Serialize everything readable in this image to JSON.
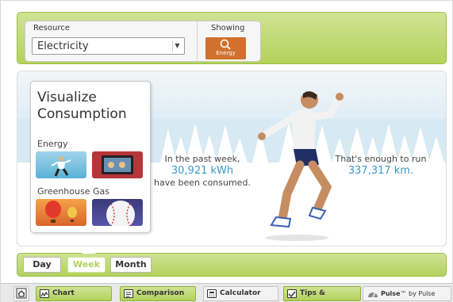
{
  "resource": {
    "label": "Resource",
    "selected": "Electricity"
  },
  "showing": {
    "label": "Showing",
    "button_label": "Energy"
  },
  "visualize": {
    "title_line1": "Visualize",
    "title_line2": "Consumption",
    "energy_label": "Energy",
    "ghg_label": "Greenhouse Gas"
  },
  "summary": {
    "left_line1": "In the past week,",
    "value": "30,921 kWh",
    "left_line3": "have been consumed.",
    "right_line1": "That's enough to run",
    "equivalent": "337,317 km."
  },
  "period_tabs": [
    "Day",
    "Week",
    "Month"
  ],
  "active_period": "Week",
  "footer": {
    "chart": "Chart",
    "comparison": "Comparison",
    "calculator": "Calculator",
    "tips": "Tips & Feedback",
    "pulse_brand": "Pulse",
    "pulse_suffix": "™ by Pulse Energy"
  },
  "colors": {
    "accent_green": "#b4d25c",
    "energy_orange": "#d2702e",
    "value_blue": "#3a9bc9"
  }
}
